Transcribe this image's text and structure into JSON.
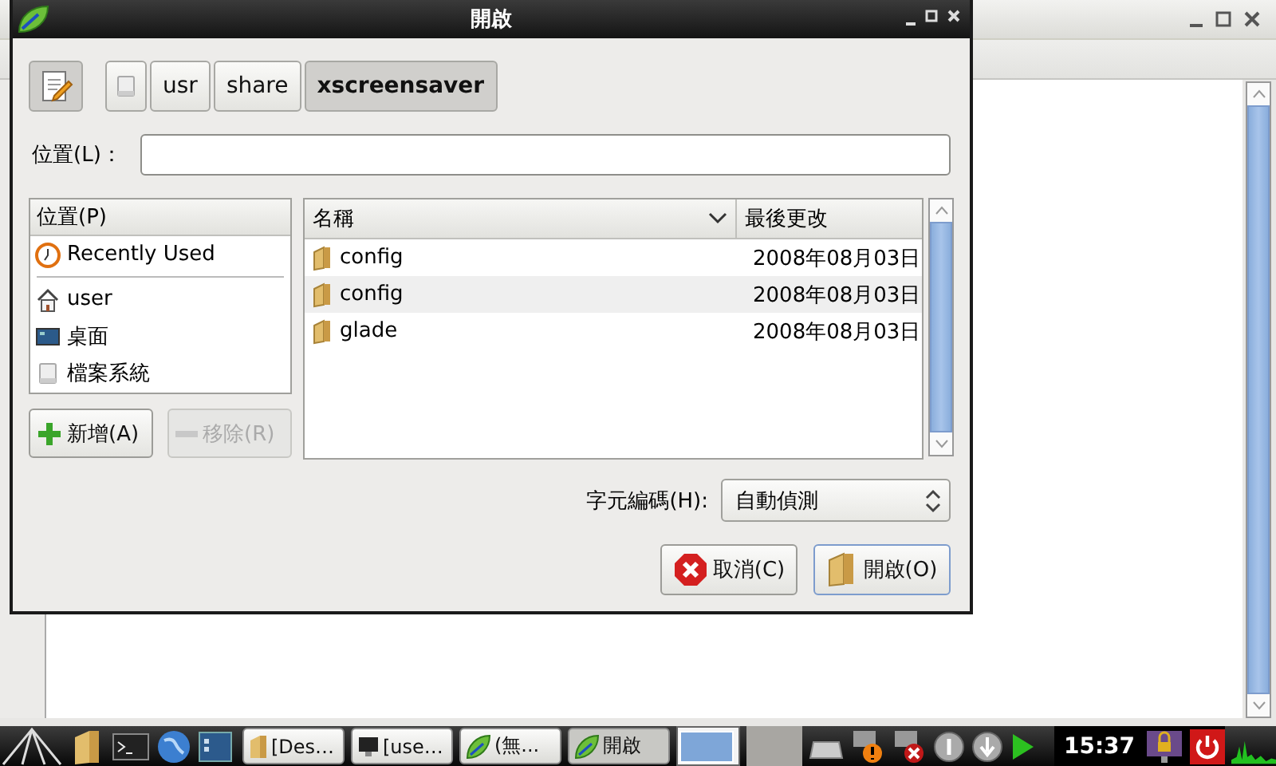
{
  "dialog": {
    "title": "開啟",
    "path_buttons": [
      {
        "kind": "drive",
        "selected": false
      },
      {
        "kind": "folder",
        "label": "usr",
        "selected": false
      },
      {
        "kind": "folder",
        "label": "share",
        "selected": false
      },
      {
        "kind": "folder",
        "label": "xscreensaver",
        "selected": true
      }
    ],
    "location": {
      "label": "位置(L)："
    },
    "places": {
      "header": "位置(P)",
      "groups": [
        [
          {
            "kind": "recent",
            "label": "Recently Used"
          }
        ],
        [
          {
            "kind": "home",
            "label": "user"
          },
          {
            "kind": "desktop",
            "label": "桌面"
          },
          {
            "kind": "drive",
            "label": "檔案系統"
          }
        ]
      ]
    },
    "place_buttons": [
      {
        "kind": "add",
        "label": "新增(A)",
        "disabled": false
      },
      {
        "kind": "remove",
        "label": "移除(R)",
        "disabled": true
      }
    ],
    "files": {
      "columns": [
        "名稱",
        "最後更改"
      ],
      "rows": [
        {
          "name": "config",
          "modified": "2008年08月03日"
        },
        {
          "name": "config",
          "modified": "2008年08月03日"
        },
        {
          "name": "glade",
          "modified": "2008年08月03日"
        }
      ]
    },
    "encoding": {
      "label": "字元編碼(H):",
      "value": "自動偵測"
    },
    "buttons": [
      {
        "kind": "cancel",
        "label": "取消(C)"
      },
      {
        "kind": "open",
        "label": "開啟(O)"
      }
    ]
  },
  "taskbar": {
    "tasks": [
      {
        "kind": "folder",
        "label": "[Des…",
        "selected": false
      },
      {
        "kind": "monitor",
        "label": "[use…",
        "selected": false
      },
      {
        "kind": "leaf",
        "label": "(無...",
        "selected": false
      },
      {
        "kind": "leaf",
        "label": "開啟",
        "selected": true
      }
    ],
    "clock": "15:37"
  }
}
